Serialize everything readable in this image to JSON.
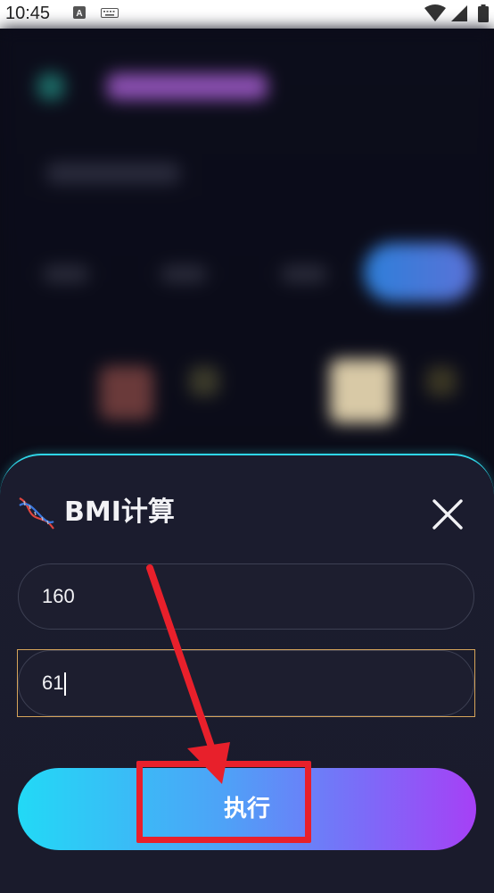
{
  "status_bar": {
    "time": "10:45",
    "icons": [
      "a-notification-icon",
      "keyboard-icon",
      "wifi-icon",
      "signal-icon",
      "battery-icon"
    ]
  },
  "dialog": {
    "title": "BMI计算",
    "title_icon": "dna-icon",
    "close_icon": "close-icon",
    "fields": [
      {
        "value": "160",
        "focused": false
      },
      {
        "value": "61",
        "focused": true
      }
    ],
    "action_button_label": "执行"
  },
  "annotations": {
    "arrow_color": "#e8202b",
    "highlight_color": "#e8202b"
  },
  "colors": {
    "sheet_background": "#1b1c2e",
    "sheet_border": "#2fd6e8",
    "button_gradient_start": "#22d9f6",
    "button_gradient_end": "#a640f6",
    "focus_border": "#d6a45a"
  }
}
